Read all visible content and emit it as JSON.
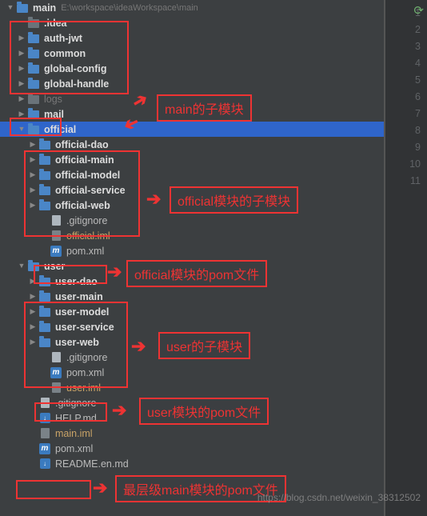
{
  "root": {
    "name": "main",
    "path": "E:\\workspace\\ideaWorkspace\\main"
  },
  "tree": [
    {
      "t": "dir-dim",
      "n": ".idea",
      "lv": 2,
      "a": ""
    },
    {
      "t": "mod",
      "n": "auth-jwt",
      "lv": 2,
      "a": "▶"
    },
    {
      "t": "mod",
      "n": "common",
      "lv": 2,
      "a": "▶"
    },
    {
      "t": "mod",
      "n": "global-config",
      "lv": 2,
      "a": "▶"
    },
    {
      "t": "mod",
      "n": "global-handle",
      "lv": 2,
      "a": "▶"
    },
    {
      "t": "dir-dim",
      "n": "logs",
      "lv": 2,
      "a": "▶",
      "labeldim": true
    },
    {
      "t": "mod",
      "n": "mail",
      "lv": 2,
      "a": "▶"
    },
    {
      "t": "mod",
      "n": "official",
      "lv": 2,
      "a": "▼",
      "sel": true
    },
    {
      "t": "mod",
      "n": "official-dao",
      "lv": 3,
      "a": "▶"
    },
    {
      "t": "mod",
      "n": "official-main",
      "lv": 3,
      "a": "▶"
    },
    {
      "t": "mod",
      "n": "official-model",
      "lv": 3,
      "a": "▶"
    },
    {
      "t": "mod",
      "n": "official-service",
      "lv": 3,
      "a": "▶"
    },
    {
      "t": "mod",
      "n": "official-web",
      "lv": 3,
      "a": "▶"
    },
    {
      "t": "file",
      "n": ".gitignore",
      "lv": 4,
      "a": ""
    },
    {
      "t": "iml",
      "n": "official.iml",
      "lv": 4,
      "a": ""
    },
    {
      "t": "pom",
      "n": "pom.xml",
      "lv": 4,
      "a": ""
    },
    {
      "t": "mod",
      "n": "user",
      "lv": 2,
      "a": "▼"
    },
    {
      "t": "mod",
      "n": "user-dao",
      "lv": 3,
      "a": "▶"
    },
    {
      "t": "mod",
      "n": "user-main",
      "lv": 3,
      "a": "▶"
    },
    {
      "t": "mod",
      "n": "user-model",
      "lv": 3,
      "a": "▶"
    },
    {
      "t": "mod",
      "n": "user-service",
      "lv": 3,
      "a": "▶"
    },
    {
      "t": "mod",
      "n": "user-web",
      "lv": 3,
      "a": "▶"
    },
    {
      "t": "file",
      "n": ".gitignore",
      "lv": 4,
      "a": ""
    },
    {
      "t": "pom",
      "n": "pom.xml",
      "lv": 4,
      "a": ""
    },
    {
      "t": "iml",
      "n": "user.iml",
      "lv": 4,
      "a": ""
    },
    {
      "t": "file",
      "n": ".gitignore",
      "lv": 3,
      "a": ""
    },
    {
      "t": "md",
      "n": "HELP.md",
      "lv": 3,
      "a": ""
    },
    {
      "t": "iml",
      "n": "main.iml",
      "lv": 3,
      "a": ""
    },
    {
      "t": "pom",
      "n": "pom.xml",
      "lv": 3,
      "a": ""
    },
    {
      "t": "md",
      "n": "README.en.md",
      "lv": 3,
      "a": ""
    }
  ],
  "gutter": [
    "1",
    "2",
    "3",
    "4",
    "5",
    "6",
    "7",
    "8",
    "9",
    "10",
    "11"
  ],
  "annotations": {
    "a1": "main的子模块",
    "a2": "official模块的子模块",
    "a3": "official模块的pom文件",
    "a4": "user的子模块",
    "a5": "user模块的pom文件",
    "a6": "最层级main模块的pom文件"
  },
  "pom_icon": "m",
  "watermark": "https://blog.csdn.net/weixin_38312502"
}
